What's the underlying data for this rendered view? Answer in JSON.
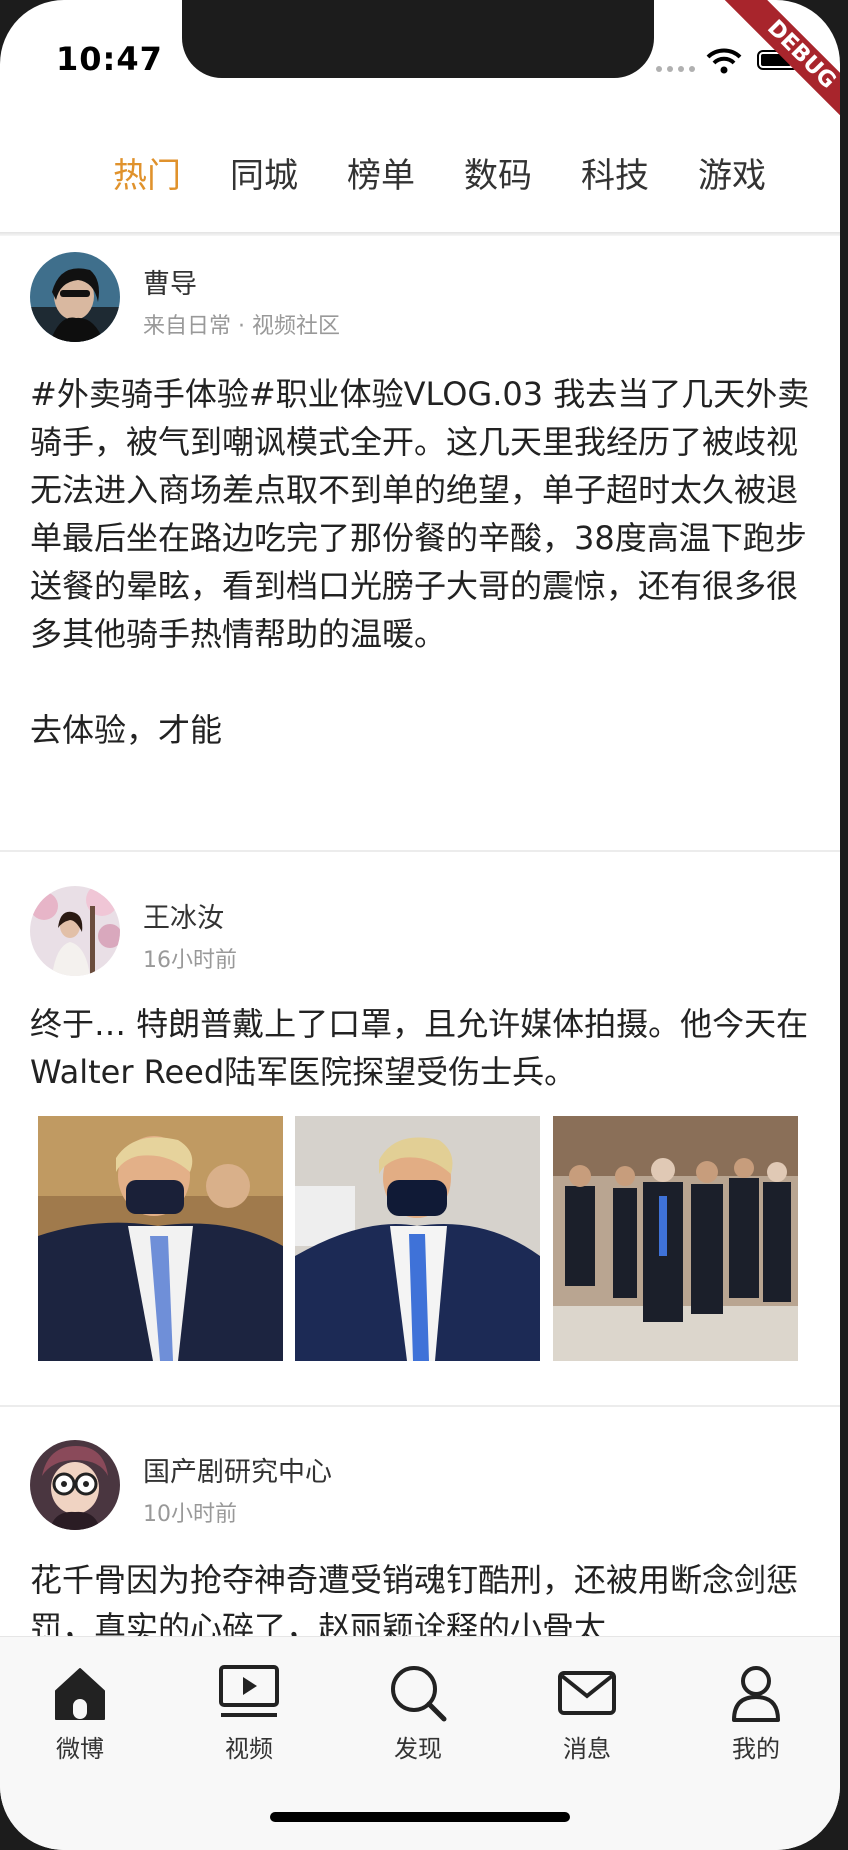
{
  "status_bar": {
    "time": "10:47",
    "debug_label": "DEBUG"
  },
  "tabs": [
    {
      "label": "热门",
      "active": true
    },
    {
      "label": "同城",
      "active": false
    },
    {
      "label": "榜单",
      "active": false
    },
    {
      "label": "数码",
      "active": false
    },
    {
      "label": "科技",
      "active": false
    },
    {
      "label": "游戏",
      "active": false
    }
  ],
  "accent_color": "#e0922c",
  "posts": [
    {
      "author": "曹导",
      "meta": "来自日常 · 视频社区",
      "text": "#外卖骑手体验#职业体验VLOG.03 我去当了几天外卖骑手，被气到嘲讽模式全开。这几天里我经历了被歧视无法进入商场差点取不到单的绝望，单子超时太久被退单最后坐在路边吃完了那份餐的辛酸，38度高温下跑步送餐的晕眩，看到档口光膀子大哥的震惊，还有很多很多其他骑手热情帮助的温暖。\n\n去体验，才能"
    },
    {
      "author": "王冰汝",
      "meta": "16小时前",
      "text": "终于… 特朗普戴上了口罩，且允许媒体拍摄。他今天在Walter Reed陆军医院探望受伤士兵。"
    },
    {
      "author": "国产剧研究中心",
      "meta": "10小时前",
      "text": "花千骨因为抢夺神奇遭受销魂钉酷刑，还被用断念剑惩罚，真实的心碎了，赵丽颖诠释的小骨太"
    }
  ],
  "bottom_nav": [
    {
      "label": "微博",
      "icon": "home-icon"
    },
    {
      "label": "视频",
      "icon": "video-icon"
    },
    {
      "label": "发现",
      "icon": "search-icon"
    },
    {
      "label": "消息",
      "icon": "mail-icon"
    },
    {
      "label": "我的",
      "icon": "profile-icon"
    }
  ]
}
